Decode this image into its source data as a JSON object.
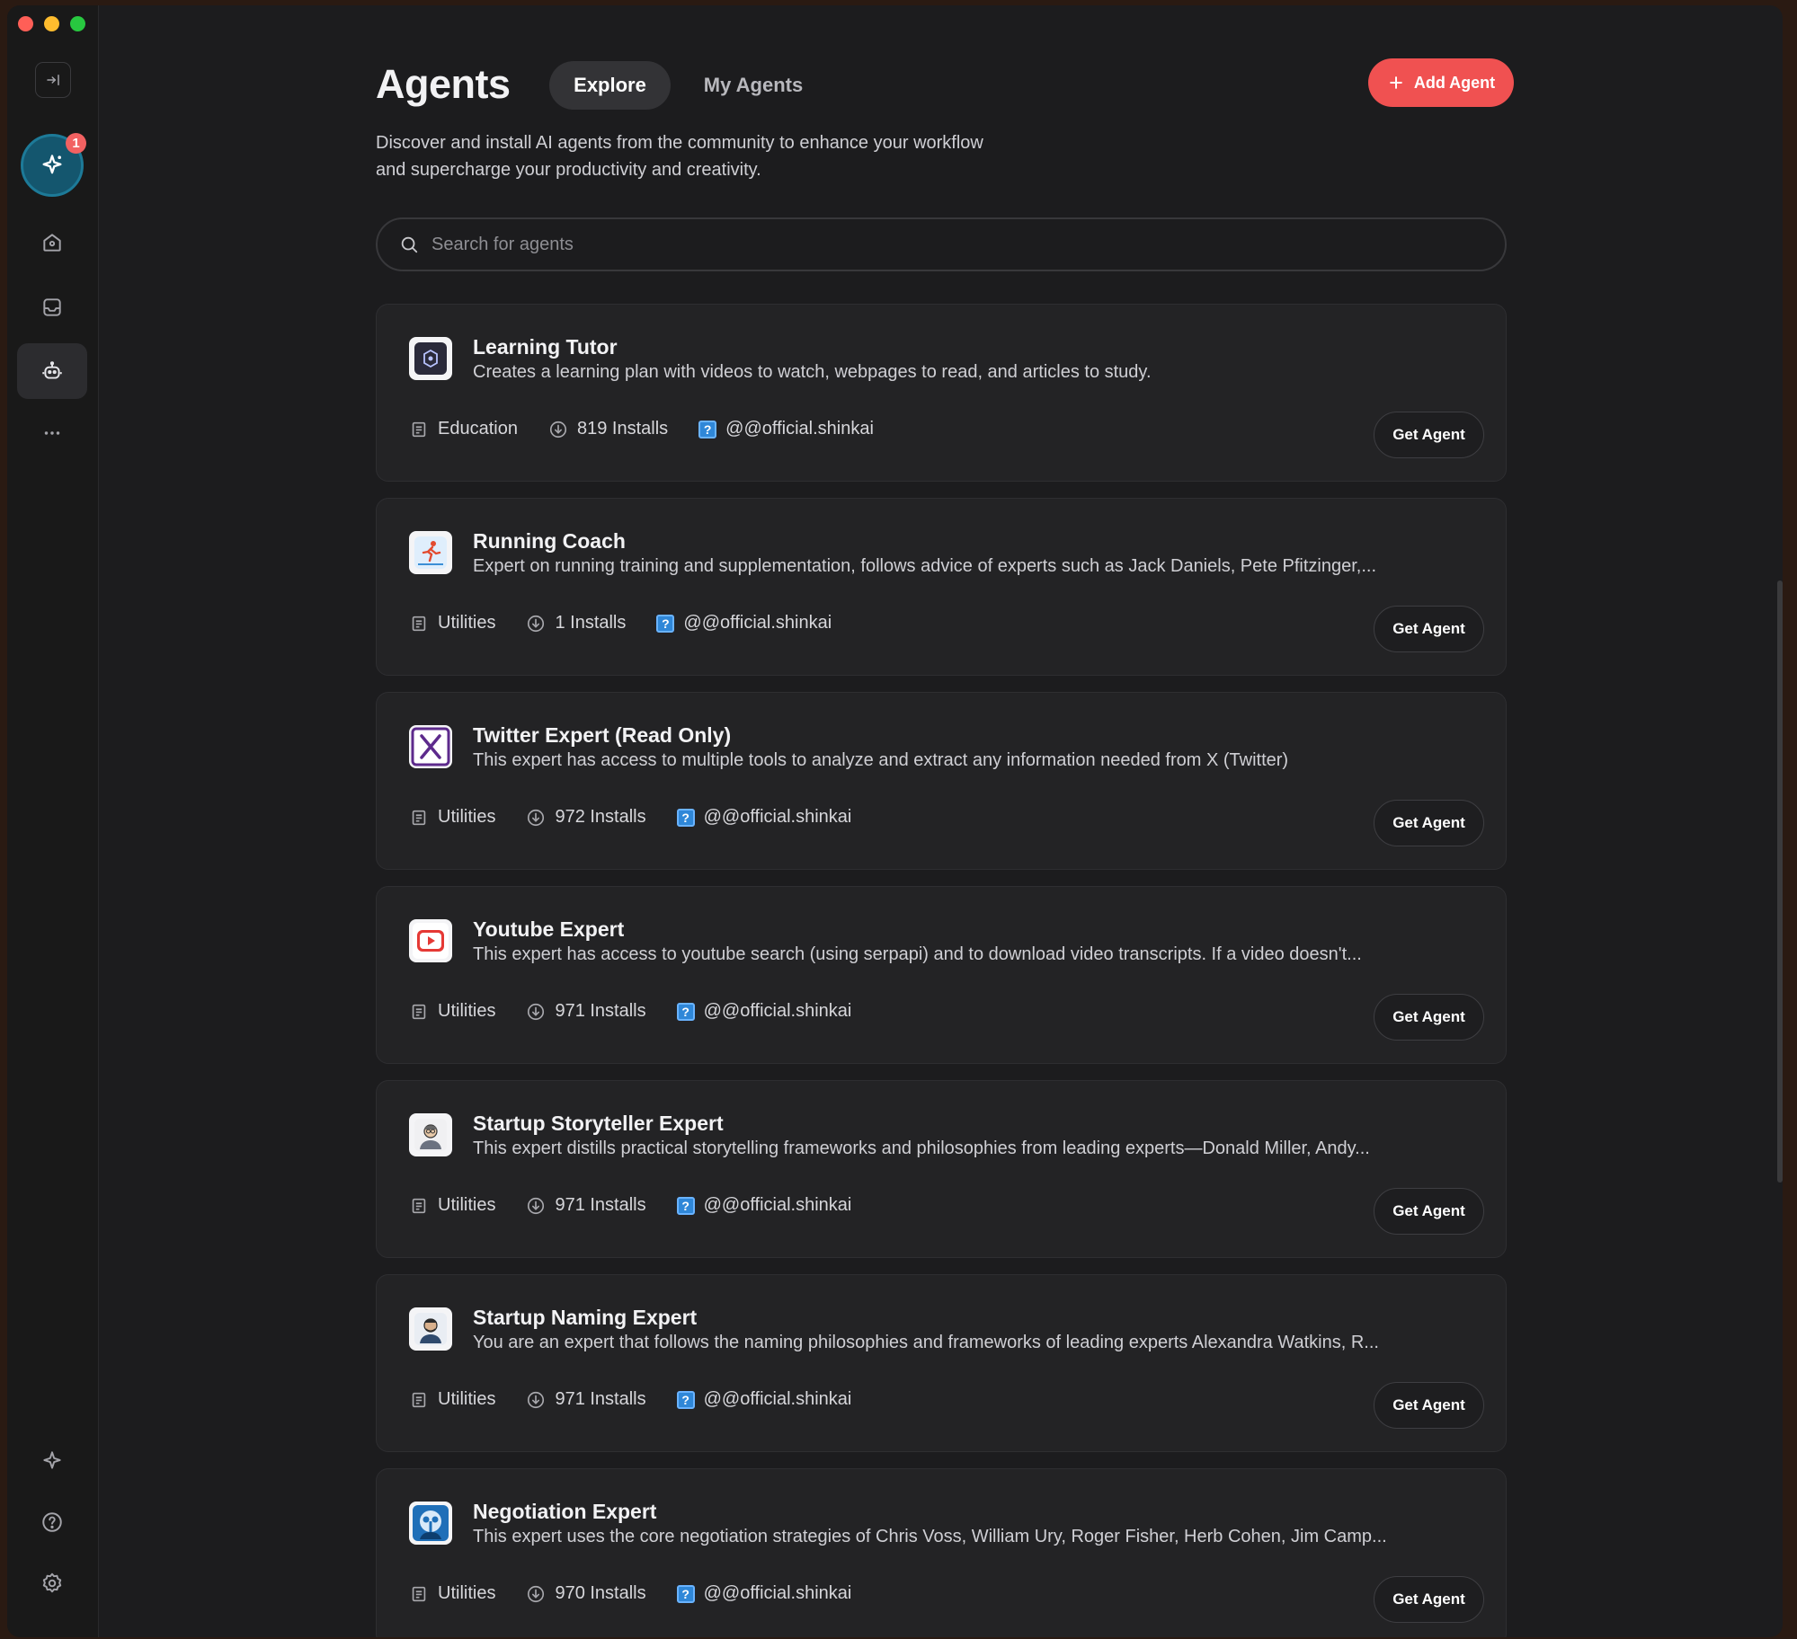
{
  "header": {
    "title": "Agents",
    "tabs": [
      {
        "label": "Explore",
        "active": true
      },
      {
        "label": "My Agents",
        "active": false
      }
    ],
    "add_button_label": "Add Agent",
    "subtitle_line1": "Discover and install AI agents from the community to enhance your workflow",
    "subtitle_line2": "and supercharge your productivity and creativity."
  },
  "search": {
    "placeholder": "Search for agents",
    "value": ""
  },
  "sidebar": {
    "notification_count": "1",
    "items": [
      "collapse-icon",
      "ai-sparkle-icon",
      "home-icon",
      "inbox-icon",
      "robot-icon",
      "more-icon",
      "sparkle-icon",
      "help-icon",
      "settings-icon"
    ],
    "active_item": "robot-icon"
  },
  "colors": {
    "accent": "#f05151",
    "background": "#1c1c1e",
    "card": "#232325"
  },
  "agents": [
    {
      "name": "Learning Tutor",
      "description": "Creates a learning plan with videos to watch, webpages to read, and articles to study.",
      "category": "Education",
      "installs": "819 Installs",
      "author": "@@official.shinkai",
      "button": "Get Agent",
      "icon": "shield-logo-icon"
    },
    {
      "name": "Running Coach",
      "description": "Expert on running training and supplementation, follows advice of experts such as Jack Daniels, Pete Pfitzinger,...",
      "category": "Utilities",
      "installs": "1 Installs",
      "author": "@@official.shinkai",
      "button": "Get Agent",
      "icon": "runner-icon"
    },
    {
      "name": "Twitter Expert (Read Only)",
      "description": "This expert has access to multiple tools to analyze and extract any information needed from X (Twitter)",
      "category": "Utilities",
      "installs": "972 Installs",
      "author": "@@official.shinkai",
      "button": "Get Agent",
      "icon": "x-logo-icon"
    },
    {
      "name": "Youtube Expert",
      "description": "This expert has access to youtube search (using serpapi) and to download video transcripts. If a video doesn't...",
      "category": "Utilities",
      "installs": "971 Installs",
      "author": "@@official.shinkai",
      "button": "Get Agent",
      "icon": "youtube-icon"
    },
    {
      "name": "Startup Storyteller Expert",
      "description": "This expert distills practical storytelling frameworks and philosophies from leading experts—Donald Miller, Andy...",
      "category": "Utilities",
      "installs": "971 Installs",
      "author": "@@official.shinkai",
      "button": "Get Agent",
      "icon": "storyteller-avatar-icon"
    },
    {
      "name": "Startup Naming Expert",
      "description": "You are an expert that follows the naming philosophies and frameworks of leading experts Alexandra Watkins, R...",
      "category": "Utilities",
      "installs": "971 Installs",
      "author": "@@official.shinkai",
      "button": "Get Agent",
      "icon": "naming-avatar-icon"
    },
    {
      "name": "Negotiation Expert",
      "description": "This expert uses the core negotiation strategies of Chris Voss, William Ury, Roger Fisher, Herb Cohen, Jim Camp...",
      "category": "Utilities",
      "installs": "970 Installs",
      "author": "@@official.shinkai",
      "button": "Get Agent",
      "icon": "negotiation-avatar-icon"
    }
  ]
}
